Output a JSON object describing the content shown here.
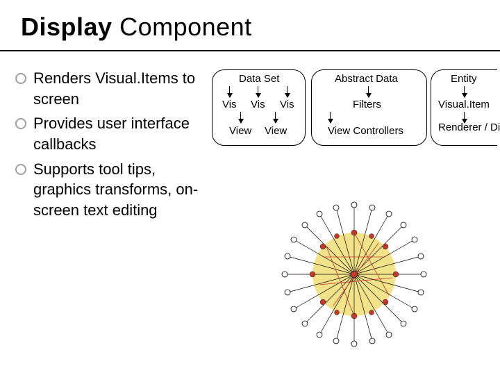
{
  "title_bold": "Display",
  "title_rest": " Component",
  "bullets": [
    "Renders Visual.Items to screen",
    "Provides user interface callbacks",
    "Supports tool tips, graphics transforms, on-screen text editing"
  ],
  "diagram": {
    "blockA": {
      "top": "Data Set",
      "mid1": "Vis",
      "mid2": "Vis",
      "mid3": "Vis",
      "bot1": "View",
      "bot2": "View"
    },
    "blockB": {
      "top": "Abstract Data",
      "mid": "Filters",
      "bot": "View Controllers"
    },
    "blockC": {
      "top": "Entity",
      "mid": "Visual.Item",
      "bot": "Renderer / Display"
    }
  }
}
